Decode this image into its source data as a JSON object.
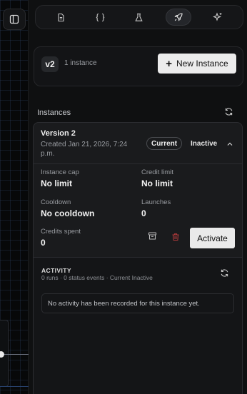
{
  "icons": {
    "sidebar_toggle": "sidebar-toggle-icon",
    "toolbar": [
      "document-icon",
      "braces-icon",
      "flask-icon",
      "rocket-icon",
      "sparkles-icon"
    ]
  },
  "toolbar": {
    "active_index": 3
  },
  "version": {
    "badge": "v2",
    "instance_count": "1 instance",
    "new_instance_label": "New Instance"
  },
  "instances": {
    "section_title": "Instances",
    "items": [
      {
        "title": "Version 2",
        "created": "Created Jan 21, 2026, 7:24 p.m.",
        "current_label": "Current",
        "status_label": "Inactive",
        "instance_cap_label": "Instance cap",
        "instance_cap_value": "No limit",
        "credit_limit_label": "Credit limit",
        "credit_limit_value": "No limit",
        "cooldown_label": "Cooldown",
        "cooldown_value": "No cooldown",
        "launches_label": "Launches",
        "launches_value": "0",
        "credits_spent_label": "Credits spent",
        "credits_spent_value": "0",
        "activate_label": "Activate",
        "activity": {
          "title": "ACTIVITY",
          "meta": "0 runs · 0 status events · Current Inactive",
          "empty_message": "No activity has been recorded for this instance yet."
        }
      }
    ]
  },
  "colors": {
    "background": "#0f1011",
    "card": "#1a1b1d",
    "primary_button": "#ececec",
    "delete_red": "#b03a3a"
  }
}
